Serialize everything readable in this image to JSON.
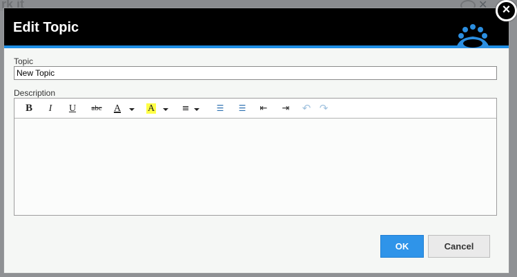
{
  "background": {
    "partial_title": "rk  it"
  },
  "dialog": {
    "title": "Edit Topic",
    "accent_color": "#1f8fe6",
    "topic_label": "Topic",
    "topic_value": "New Topic",
    "description_label": "Description",
    "ok_label": "OK",
    "cancel_label": "Cancel",
    "close_glyph": "×"
  },
  "toolbar": {
    "bold": "B",
    "italic": "I",
    "underline": "U",
    "strike": "abc",
    "font_color": "A",
    "highlight": "A",
    "align": "≡",
    "bullets": "☰",
    "numbered": "☰",
    "outdent": "⇤",
    "indent": "⇥",
    "undo": "↶",
    "redo": "↷"
  },
  "colors": {
    "ok_button": "#2f94e9",
    "highlight": "#ffff44"
  }
}
